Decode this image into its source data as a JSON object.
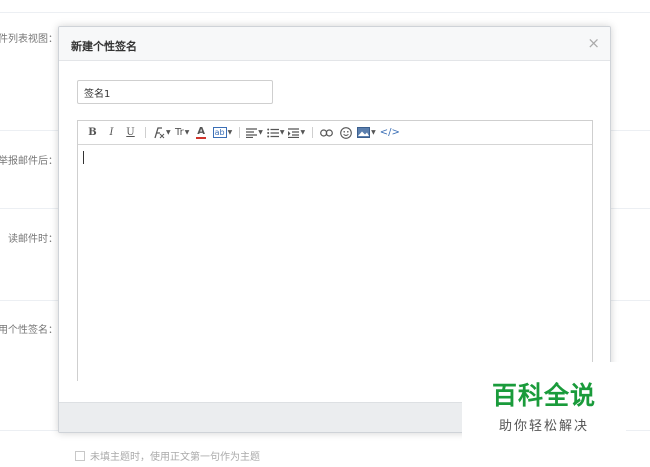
{
  "background": {
    "labels": [
      "件列表视图：",
      "举报邮件后：",
      "读邮件时：",
      "用个性签名："
    ],
    "checkbox_label": "未填主题时，使用正文第一句作为主题"
  },
  "dialog": {
    "title": "新建个性签名",
    "close_glyph": "×",
    "name_value": "签名1",
    "toolbar": {
      "bold": "B",
      "italic": "I",
      "underline": "U",
      "font_family_icon": "font-family-icon",
      "font_size": "Tr",
      "font_color": "A",
      "background_color": "ab",
      "align_icon": "align-icon",
      "list_icon": "list-icon",
      "indent_icon": "indent-icon",
      "link_icon": "link-icon",
      "emoji_icon": "emoji-icon",
      "image_icon": "image-icon",
      "source": "</>"
    }
  },
  "watermark": {
    "main": "百科全说",
    "sub": "助你轻松解决"
  },
  "colors": {
    "watermark_green": "#1a9b3b",
    "font_color_red": "#d0342c",
    "bg_color_blue": "#3b6fb6"
  }
}
